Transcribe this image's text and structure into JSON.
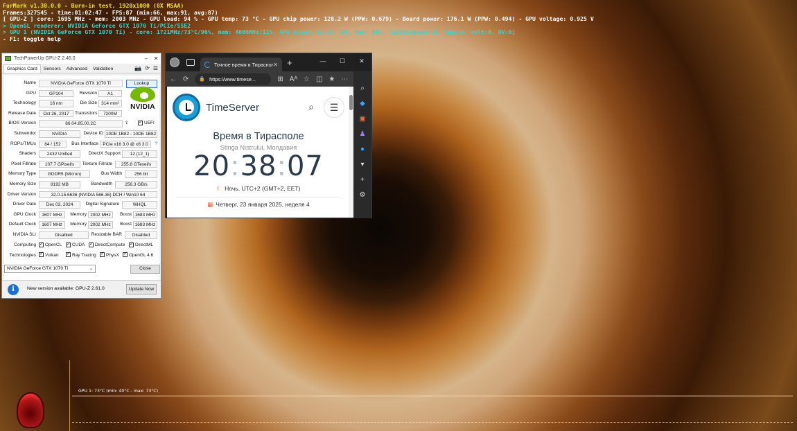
{
  "furmark": {
    "line1": "FurMark v1.38.0.0 - Burn-in test, 1920x1080 (8X MSAA)",
    "line2": "Frames:327545 - time:01:02:47 - FPS:87 (min:66, max:91, avg:87)",
    "line3": "[ GPU-Z ] core: 1695 MHz - mem: 2003 MHz - GPU load: 94 % - GPU temp: 73 °C - GPU chip power: 128.2 W (PPW: 0.679) - Board power: 176.1 W (PPW: 0.494) - GPU voltage: 0.925 V",
    "line4": "> OpenGL renderer: NVIDIA GeForce GTX 1070 Ti/PCIe/SSE2",
    "line5": "> GPU 1 (NVIDIA GeForce GTX 1070 Ti) - core: 1721MHz/73°C/96%, mem: 4006MHz/11%, GPU power: 98.0% TDP, fan: 80%, limits[power:0, temp:0, volt:0, OV:0]",
    "line6": "- F1: toggle help",
    "graph_label": "GPU 1: 73°C (min: 40°C - max: 73°C)"
  },
  "gpuz": {
    "title": "TechPowerUp GPU-Z 2.46.0",
    "tabs": [
      "Graphics Card",
      "Sensors",
      "Advanced",
      "Validation"
    ],
    "lookup": "Lookup",
    "nvidia_word": "NVIDIA",
    "labels": {
      "name": "Name",
      "gpu": "GPU",
      "revision": "Revision",
      "technology": "Technology",
      "die_size": "Die Size",
      "release_date": "Release Date",
      "transistors": "Transistors",
      "bios": "BIOS Version",
      "uefi": "UEFI",
      "subvendor": "Subvendor",
      "device_id": "Device ID",
      "rops": "ROPs/TMUs",
      "bus_interface": "Bus Interface",
      "shaders": "Shaders",
      "directx": "DirectX Support",
      "pixel_fillrate": "Pixel Fillrate",
      "texture_fillrate": "Texture Fillrate",
      "memory_type": "Memory Type",
      "bus_width": "Bus Width",
      "memory_size": "Memory Size",
      "bandwidth": "Bandwidth",
      "driver_version": "Driver Version",
      "driver_date": "Driver Date",
      "digital_signature": "Digital Signature",
      "gpu_clock": "GPU Clock",
      "memory": "Memory",
      "boost": "Boost",
      "default_clock": "Default Clock",
      "nvidia_sli": "NVIDIA SLI",
      "resizable_bar": "Resizable BAR",
      "computing": "Computing",
      "technologies": "Technologies"
    },
    "values": {
      "name": "NVIDIA GeForce GTX 1070 Ti",
      "gpu": "GP104",
      "revision": "A1",
      "technology": "16 nm",
      "die_size": "314 mm²",
      "release_date": "Oct 26, 2017",
      "transistors": "7200M",
      "bios": "86.04.85.00.2C",
      "subvendor": "NVIDIA",
      "device_id": "10DE 1B82 - 10DE 1B82",
      "rops": "64 / 152",
      "bus_interface": "PCIe x16 3.0 @ x8 3.0",
      "shaders": "2432 Unified",
      "directx": "12 (12_1)",
      "pixel_fillrate": "107.7 GPixel/s",
      "texture_fillrate": "255.8 GTexel/s",
      "memory_type": "GDDR5 (Micron)",
      "bus_width": "256 bit",
      "memory_size": "8192 MB",
      "bandwidth": "256.3 GB/s",
      "driver_version": "32.0.15.6636 (NVIDIA 566.36) DCH / Win10 64",
      "driver_date": "Dec 03, 2024",
      "digital_signature": "WHQL",
      "gpu_clock": "1607 MHz",
      "gpu_memory": "2002 MHz",
      "gpu_boost": "1683 MHz",
      "default_clock": "1607 MHz",
      "default_memory": "2002 MHz",
      "default_boost": "1683 MHz",
      "nvidia_sli": "Disabled",
      "resizable_bar": "Disabled"
    },
    "computing": [
      "OpenCL",
      "CUDA",
      "DirectCompute",
      "DirectML"
    ],
    "technologies": [
      "Vulkan",
      "Ray Tracing",
      "PhysX",
      "OpenGL 4.6"
    ],
    "selected_gpu": "NVIDIA GeForce GTX 1070 Ti",
    "close": "Close",
    "update_text": "New version available: GPU-Z 2.61.0",
    "update_button": "Update Now"
  },
  "browser": {
    "tab_title": "Точное время в Тирасполе",
    "url_host": "https://www.timese...",
    "site_name": "TimeServer",
    "heading": "Время в Тирасполе",
    "subheading": "Stinga Nistrului, Молдавия",
    "time_h": "20",
    "time_m": "38",
    "time_s": "07",
    "zone": "Ночь, UTC+2 (GMT+2, EET)",
    "date": "Четверг, 23 января 2025, неделя 4"
  }
}
